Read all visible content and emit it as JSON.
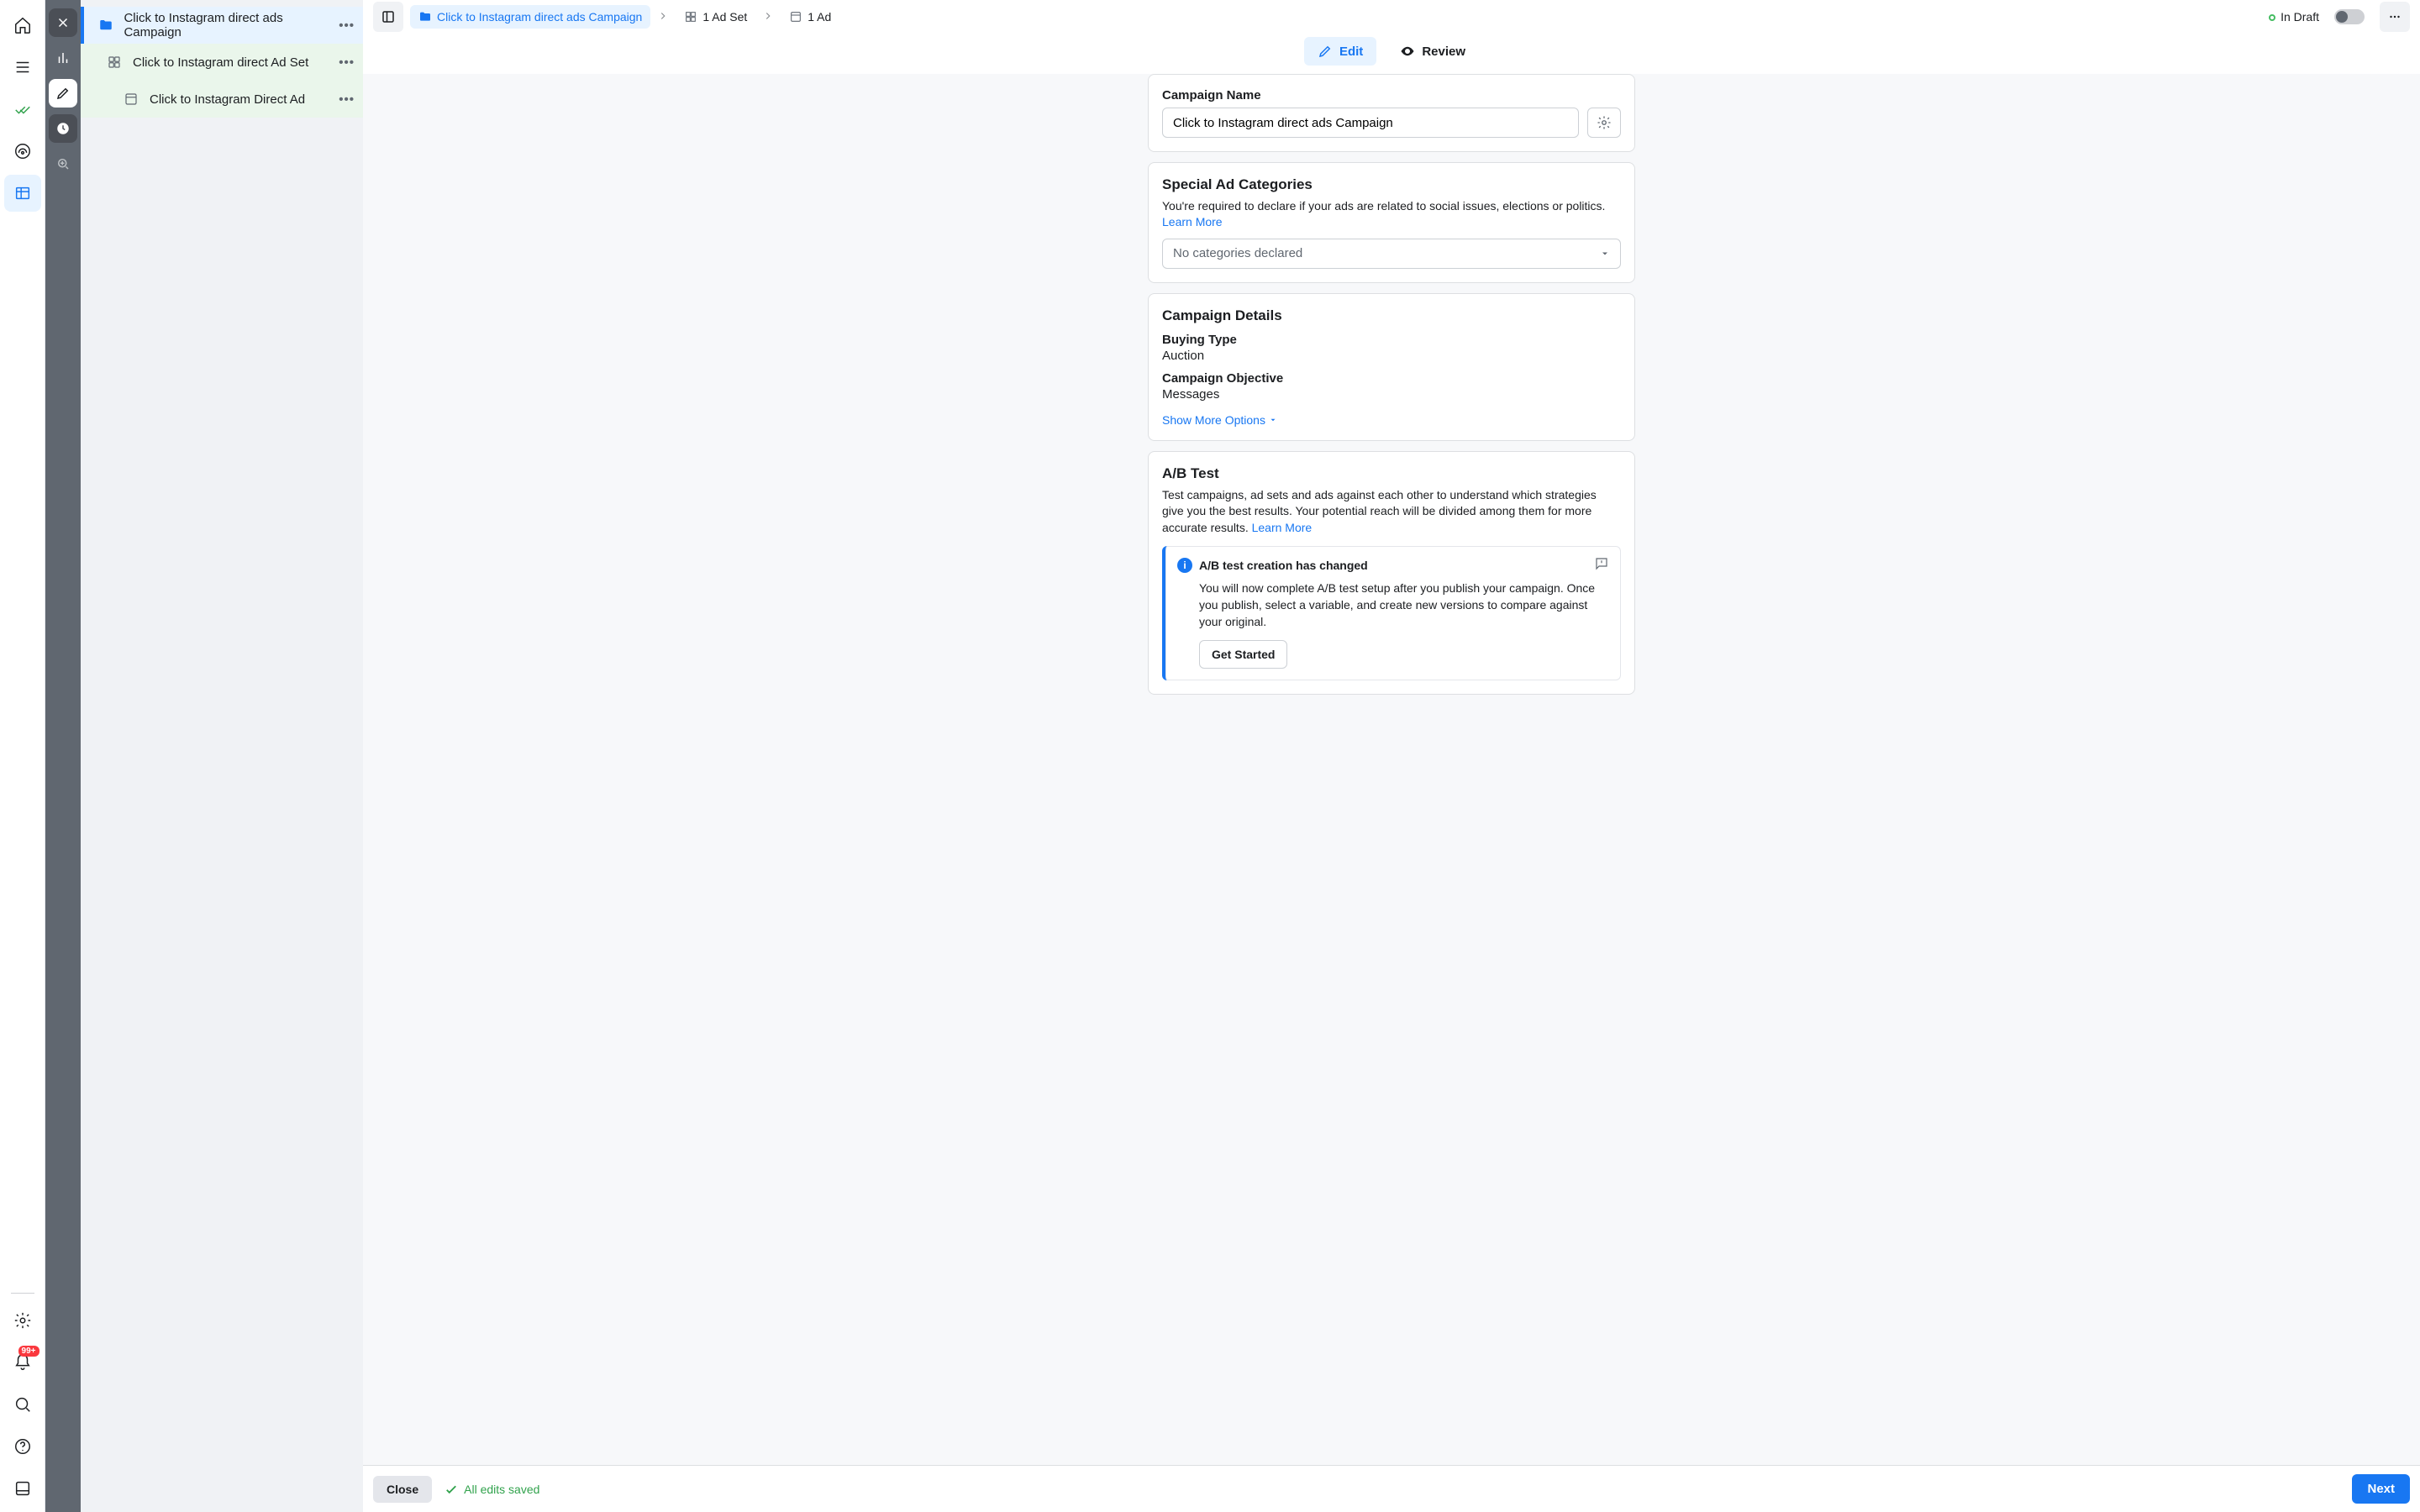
{
  "rail_a": {
    "badge": "99+"
  },
  "tree": {
    "campaign": "Click to Instagram direct ads Campaign",
    "adset": "Click to Instagram direct Ad Set",
    "ad": "Click to Instagram Direct Ad"
  },
  "topbar": {
    "crumb_campaign": "Click to Instagram direct ads Campaign",
    "crumb_adset_count": "1 Ad Set",
    "crumb_ad_count": "1 Ad",
    "draft_label": "In Draft"
  },
  "tabs": {
    "edit": "Edit",
    "review": "Review"
  },
  "campaign_name_card": {
    "label": "Campaign Name",
    "value": "Click to Instagram direct ads Campaign"
  },
  "special_ad": {
    "title": "Special Ad Categories",
    "text": "You're required to declare if your ads are related to social issues, elections or politics. ",
    "learn_more": "Learn More",
    "placeholder": "No categories declared"
  },
  "details": {
    "title": "Campaign Details",
    "buying_type_k": "Buying Type",
    "buying_type_v": "Auction",
    "objective_k": "Campaign Objective",
    "objective_v": "Messages",
    "show_more": "Show More Options"
  },
  "abtest": {
    "title": "A/B Test",
    "text": "Test campaigns, ad sets and ads against each other to understand which strategies give you the best results. Your potential reach will be divided among them for more accurate results. ",
    "learn_more": "Learn More",
    "notice_title": "A/B test creation has changed",
    "notice_body": "You will now complete A/B test setup after you publish your campaign. Once you publish, select a variable, and create new versions to compare against your original.",
    "get_started": "Get Started"
  },
  "footer": {
    "close": "Close",
    "saved": "All edits saved",
    "next": "Next"
  }
}
